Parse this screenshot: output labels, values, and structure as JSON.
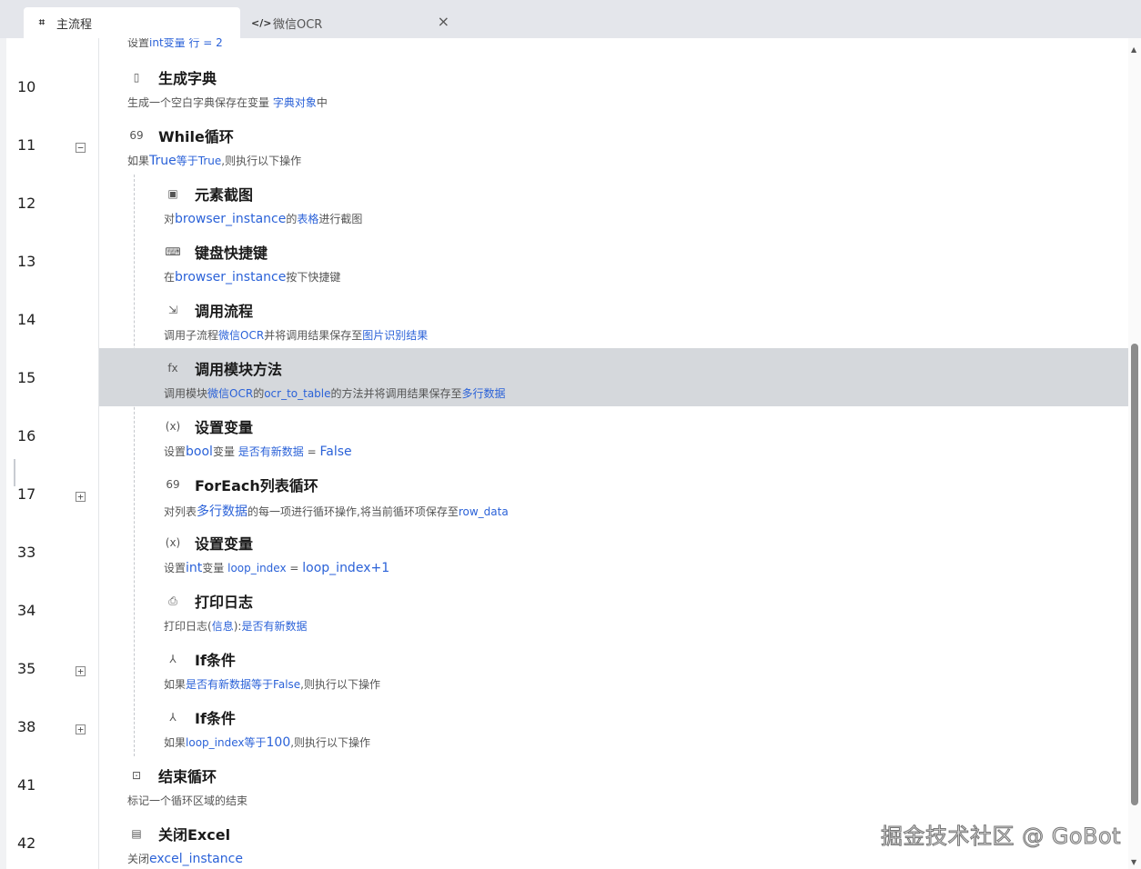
{
  "tabs": [
    {
      "label": "主流程",
      "icon": "flow-icon",
      "active": true
    },
    {
      "label": "微信OCR",
      "icon": "code-icon",
      "active": false,
      "close": "×"
    }
  ],
  "partial_top": {
    "pre": "设置",
    "kw": "int变量 行 = 2"
  },
  "gutter_lines": [
    {
      "n": "10",
      "fold": ""
    },
    {
      "n": "11",
      "fold": "−"
    },
    {
      "n": "12",
      "fold": ""
    },
    {
      "n": "13",
      "fold": ""
    },
    {
      "n": "14",
      "fold": ""
    },
    {
      "n": "15",
      "fold": ""
    },
    {
      "n": "16",
      "fold": ""
    },
    {
      "n": "17",
      "fold": "+"
    },
    {
      "n": "33",
      "fold": ""
    },
    {
      "n": "34",
      "fold": ""
    },
    {
      "n": "35",
      "fold": "+"
    },
    {
      "n": "38",
      "fold": "+"
    },
    {
      "n": "41",
      "fold": ""
    },
    {
      "n": "42",
      "fold": ""
    }
  ],
  "rows": [
    {
      "title": "生成字典",
      "icon": "document-icon",
      "glyph": "▯",
      "desc": [
        {
          "t": "生成一个空白字典保存在变量 "
        },
        {
          "t": "字典对象",
          "k": true
        },
        {
          "t": "中"
        }
      ]
    },
    {
      "title": "While循环",
      "icon": "loop-icon",
      "glyph": "69",
      "desc": [
        {
          "t": "如果"
        },
        {
          "t": "True",
          "k": true,
          "b": true
        },
        {
          "t": "等于",
          "k": true
        },
        {
          "t": "True",
          "k": true
        },
        {
          "t": ",则执行以下操作"
        }
      ]
    },
    {
      "title": "元素截图",
      "icon": "screenshot-icon",
      "glyph": "▣",
      "desc": [
        {
          "t": "对"
        },
        {
          "t": "browser_instance",
          "k": true,
          "b": true
        },
        {
          "t": "的"
        },
        {
          "t": "表格",
          "k": true
        },
        {
          "t": "进行截图"
        }
      ]
    },
    {
      "title": "键盘快捷键",
      "icon": "keyboard-icon",
      "glyph": "⌨",
      "desc": [
        {
          "t": "在"
        },
        {
          "t": "browser_instance",
          "k": true,
          "b": true
        },
        {
          "t": "按下快捷键"
        }
      ]
    },
    {
      "title": "调用流程",
      "icon": "call-flow-icon",
      "glyph": "⇲",
      "desc": [
        {
          "t": "调用子流程"
        },
        {
          "t": "微信OCR",
          "k": true
        },
        {
          "t": "并将调用结果保存至"
        },
        {
          "t": "图片识别结果",
          "k": true
        }
      ]
    },
    {
      "title": "调用模块方法",
      "icon": "function-icon",
      "glyph": "fx",
      "desc": [
        {
          "t": "调用模块"
        },
        {
          "t": "微信OCR",
          "k": true
        },
        {
          "t": "的"
        },
        {
          "t": "ocr_to_table",
          "k": true
        },
        {
          "t": "的方法并将调用结果保存至"
        },
        {
          "t": "多行数据",
          "k": true
        }
      ]
    },
    {
      "title": "设置变量",
      "icon": "variable-icon",
      "glyph": "(x)",
      "desc": [
        {
          "t": "设置"
        },
        {
          "t": "bool",
          "k": true,
          "b": true
        },
        {
          "t": "变量 "
        },
        {
          "t": "是否有新数据",
          "k": true
        },
        {
          "t": " = "
        },
        {
          "t": "False",
          "k": true,
          "b": true
        }
      ]
    },
    {
      "title": "ForEach列表循环",
      "icon": "loop-icon",
      "glyph": "69",
      "desc": [
        {
          "t": "对列表"
        },
        {
          "t": "多行数据",
          "k": true,
          "b": true
        },
        {
          "t": "的每一项进行循环操作,将当前循环项保存至"
        },
        {
          "t": "row_data",
          "k": true
        }
      ]
    },
    {
      "title": "设置变量",
      "icon": "variable-icon",
      "glyph": "(x)",
      "desc": [
        {
          "t": "设置"
        },
        {
          "t": "int",
          "k": true,
          "b": true
        },
        {
          "t": "变量 "
        },
        {
          "t": "loop_index",
          "k": true
        },
        {
          "t": " = "
        },
        {
          "t": "loop_index+1",
          "k": true,
          "b": true
        }
      ]
    },
    {
      "title": "打印日志",
      "icon": "printer-icon",
      "glyph": "⎙",
      "desc": [
        {
          "t": "打印日志("
        },
        {
          "t": "信息",
          "k": true
        },
        {
          "t": "):"
        },
        {
          "t": "是否有新数据",
          "k": true
        }
      ]
    },
    {
      "title": "If条件",
      "icon": "branch-icon",
      "glyph": "⅄",
      "desc": [
        {
          "t": "如果"
        },
        {
          "t": "是否有新数据",
          "k": true
        },
        {
          "t": "等于",
          "k": true
        },
        {
          "t": "False",
          "k": true
        },
        {
          "t": ",则执行以下操作"
        }
      ]
    },
    {
      "title": "If条件",
      "icon": "branch-icon",
      "glyph": "⅄",
      "desc": [
        {
          "t": "如果"
        },
        {
          "t": "loop_index",
          "k": true
        },
        {
          "t": "等于",
          "k": true
        },
        {
          "t": "100",
          "k": true,
          "b": true
        },
        {
          "t": ",则执行以下操作"
        }
      ]
    },
    {
      "title": "结束循环",
      "icon": "end-loop-icon",
      "glyph": "⊡",
      "desc": [
        {
          "t": "标记一个循环区域的结束"
        }
      ]
    },
    {
      "title": "关闭Excel",
      "icon": "close-file-icon",
      "glyph": "▤",
      "desc": [
        {
          "t": "关闭"
        },
        {
          "t": "excel_instance",
          "k": true,
          "b": true
        }
      ]
    }
  ],
  "watermark": "掘金技术社区 @ GoBot",
  "accent": "#2b62d8"
}
